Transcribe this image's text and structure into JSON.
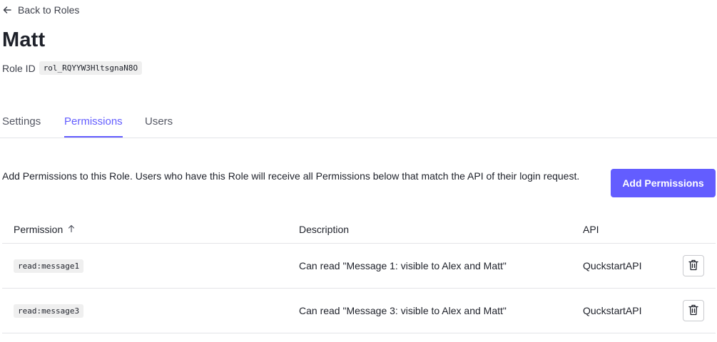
{
  "back_link": {
    "label": "Back to Roles",
    "icon": "arrow-left-icon"
  },
  "role": {
    "name": "Matt",
    "id_label": "Role ID",
    "id_value": "rol_RQYYW3HltsgnaN8O"
  },
  "tabs": [
    {
      "label": "Settings",
      "active": false
    },
    {
      "label": "Permissions",
      "active": true
    },
    {
      "label": "Users",
      "active": false
    }
  ],
  "intro": "Add Permissions to this Role. Users who have this Role will receive all Permissions below that match the API of their login request.",
  "add_button": {
    "label": "Add Permissions",
    "color": "#635dff"
  },
  "table": {
    "columns": {
      "permission": "Permission",
      "description": "Description",
      "api": "API",
      "sort_icon": "arrow-up-icon"
    },
    "rows": [
      {
        "permission": "read:message1",
        "description": "Can read \"Message 1: visible to Alex and Matt\"",
        "api": "QuckstartAPI",
        "action_icon": "trash-icon"
      },
      {
        "permission": "read:message3",
        "description": "Can read \"Message 3: visible to Alex and Matt\"",
        "api": "QuckstartAPI",
        "action_icon": "trash-icon"
      }
    ]
  },
  "colors": {
    "accent": "#635dff",
    "text": "#1e212a",
    "border": "#e3e4e8"
  }
}
